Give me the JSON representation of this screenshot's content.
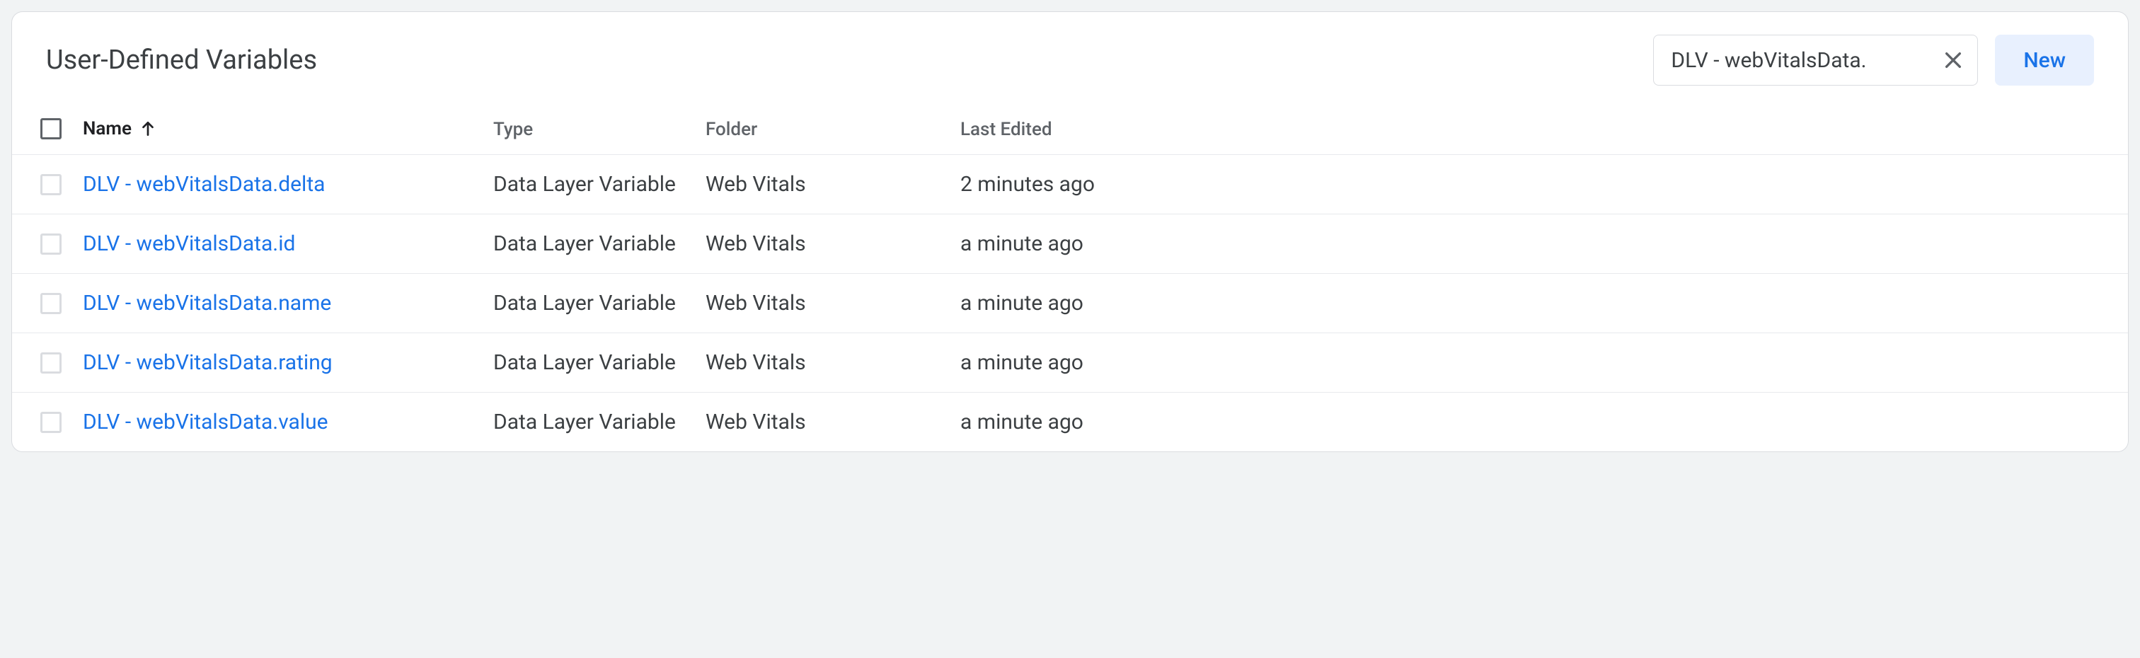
{
  "panel": {
    "title": "User-Defined Variables",
    "search_value": "DLV - webVitalsData.",
    "new_label": "New"
  },
  "columns": {
    "name": "Name",
    "type": "Type",
    "folder": "Folder",
    "last_edited": "Last Edited"
  },
  "rows": [
    {
      "name": "DLV - webVitalsData.delta",
      "type": "Data Layer Variable",
      "folder": "Web Vitals",
      "last_edited": "2 minutes ago"
    },
    {
      "name": "DLV - webVitalsData.id",
      "type": "Data Layer Variable",
      "folder": "Web Vitals",
      "last_edited": "a minute ago"
    },
    {
      "name": "DLV - webVitalsData.name",
      "type": "Data Layer Variable",
      "folder": "Web Vitals",
      "last_edited": "a minute ago"
    },
    {
      "name": "DLV - webVitalsData.rating",
      "type": "Data Layer Variable",
      "folder": "Web Vitals",
      "last_edited": "a minute ago"
    },
    {
      "name": "DLV - webVitalsData.value",
      "type": "Data Layer Variable",
      "folder": "Web Vitals",
      "last_edited": "a minute ago"
    }
  ]
}
